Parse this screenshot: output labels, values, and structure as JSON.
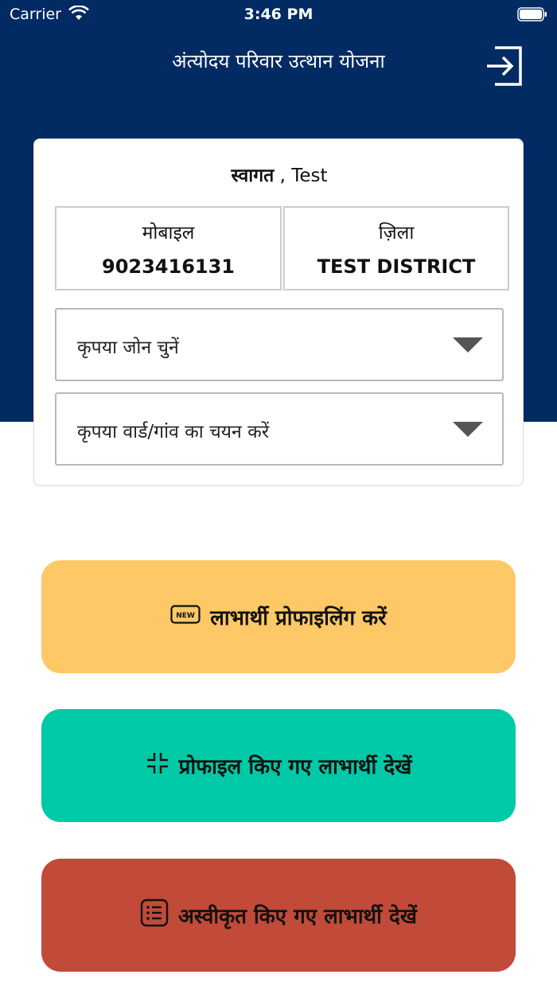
{
  "status_bar": {
    "carrier": "Carrier",
    "time": "3:46 PM"
  },
  "header": {
    "title": "अंत्योदय परिवार उत्थान योजना",
    "logout_icon": "logout-icon"
  },
  "card": {
    "welcome_label": "स्वागत",
    "welcome_separator": " , ",
    "user_name": "Test",
    "mobile": {
      "label": "मोबाइल",
      "value": "9023416131"
    },
    "district": {
      "label": "ज़िला",
      "value": "TEST DISTRICT"
    },
    "zone_select": {
      "placeholder": "कृपया जोन चुनें"
    },
    "ward_select": {
      "placeholder": "कृपया वार्ड/गांव का चयन करें"
    }
  },
  "actions": {
    "profiling": {
      "label": "लाभार्थी प्रोफाइलिंग करें",
      "badge": "NEW",
      "color": "#fdc865"
    },
    "profiled": {
      "label": "प्रोफाइल किए गए लाभार्थी देखें",
      "color": "#00c9a7"
    },
    "rejected": {
      "label": "अस्वीकृत किए गए लाभार्थी देखें",
      "color": "#c24a38"
    }
  },
  "colors": {
    "header_bg": "#022b63"
  }
}
